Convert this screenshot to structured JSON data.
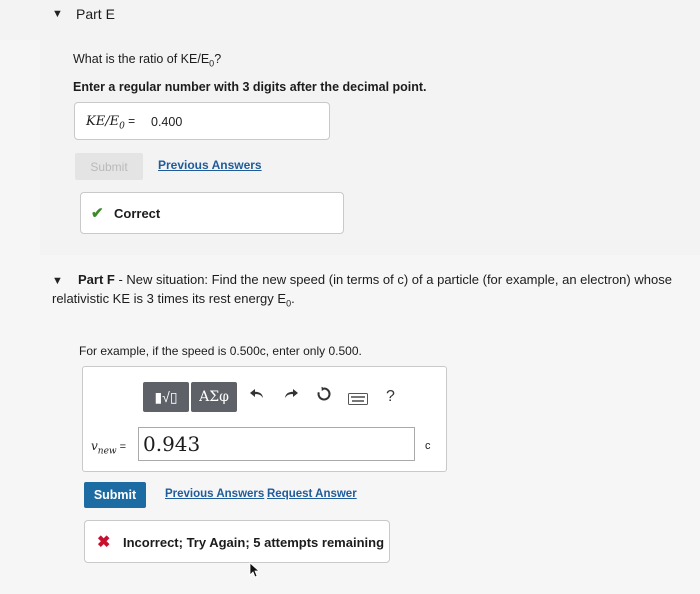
{
  "partE": {
    "title": "Part E",
    "question": "What is the ratio of KE/E",
    "question_sub": "0",
    "question_end": "?",
    "instruction": "Enter a regular number with 3 digits after the decimal point.",
    "answer_label": "KE/E",
    "answer_label_sub": "0",
    "answer_eq": " = ",
    "answer_value": "0.400",
    "submit_label": "Submit",
    "previous_answers": "Previous Answers",
    "feedback": "Correct"
  },
  "partF": {
    "title_bold": "Part F",
    "title_rest": " - New situation: Find the new speed (in terms of c) of a particle (for example, an electron) whose",
    "line2": "relativistic KE is 3 times its rest energy E",
    "line2_sub": "0",
    "line2_end": ".",
    "example": "For example, if the speed is 0.500c, enter only 0.500.",
    "toolbar": {
      "templates": "▮√▯",
      "greek": "ΑΣφ",
      "help": "?"
    },
    "input_label": "v",
    "input_label_sub": "new",
    "input_eq": " =",
    "input_value": "0.943",
    "unit": "c",
    "submit_label": "Submit",
    "previous_answers": "Previous Answers",
    "request_answer": "Request Answer",
    "feedback": "Incorrect; Try Again; 5 attempts remaining"
  },
  "colors": {
    "link": "#1f5c99",
    "submit_bg": "#1c6ba3",
    "correct": "#3e8a2b",
    "incorrect": "#c8102e"
  }
}
